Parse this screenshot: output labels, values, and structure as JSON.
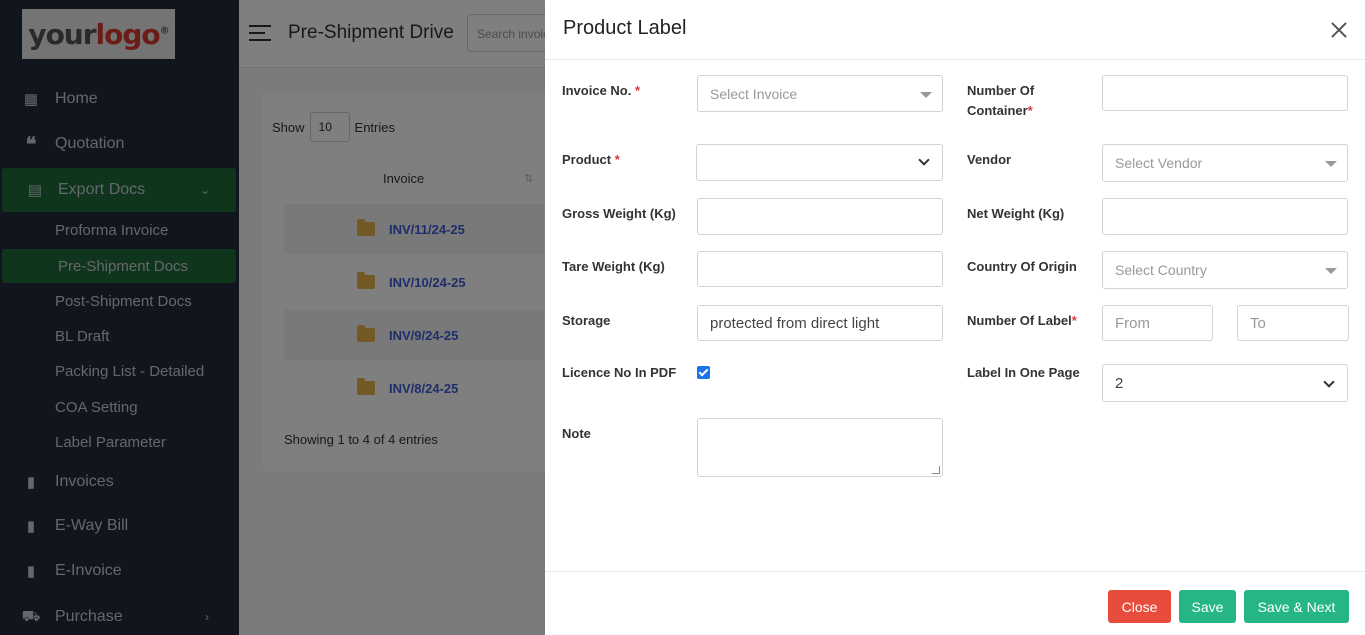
{
  "sidebar": {
    "logo": {
      "part1": "your",
      "part2": "logo",
      "mark": "®"
    },
    "items": [
      {
        "label": "Home",
        "icon": "dashboard-icon"
      },
      {
        "label": "Quotation",
        "icon": "quote-icon"
      },
      {
        "label": "Export Docs",
        "icon": "documents-icon"
      },
      {
        "label": "Invoices",
        "icon": "file-icon"
      },
      {
        "label": "E-Way Bill",
        "icon": "file-icon"
      },
      {
        "label": "E-Invoice",
        "icon": "file-icon"
      },
      {
        "label": "Purchase",
        "icon": "cart-icon"
      }
    ],
    "sub_items": [
      "Proforma Invoice",
      "Pre-Shipment Docs",
      "Post-Shipment Docs",
      "BL Draft",
      "Packing List - Detailed",
      "COA Setting",
      "Label Parameter"
    ]
  },
  "header": {
    "title": "Pre-Shipment Drive",
    "search_placeholder": "Search invoice"
  },
  "table": {
    "show_label": "Show",
    "show_value": "10",
    "entries_label": "Entries",
    "column": "Invoice",
    "rows": [
      "INV/11/24-25",
      "INV/10/24-25",
      "INV/9/24-25",
      "INV/8/24-25"
    ],
    "summary": "Showing 1 to 4 of 4 entries"
  },
  "modal": {
    "title": "Product Label",
    "fields": {
      "invoice_label": "Invoice No.",
      "invoice_placeholder": "Select Invoice",
      "containers_label_1": "Number Of",
      "containers_label_2": "Container",
      "product_label": "Product",
      "vendor_label": "Vendor",
      "vendor_placeholder": "Select Vendor",
      "gross_label": "Gross Weight (Kg)",
      "net_label": "Net Weight (Kg)",
      "tare_label": "Tare Weight (Kg)",
      "country_label": "Country Of Origin",
      "country_placeholder": "Select Country",
      "storage_label": "Storage",
      "storage_value": "protected from direct light",
      "num_label_label": "Number Of Label",
      "from_placeholder": "From",
      "to_placeholder": "To",
      "licence_label": "Licence No In PDF",
      "licence_checked": true,
      "label_page_label": "Label In One Page",
      "label_page_value": "2",
      "note_label": "Note"
    },
    "required_mark": "*",
    "buttons": {
      "close": "Close",
      "save": "Save",
      "save_next": "Save & Next"
    }
  }
}
